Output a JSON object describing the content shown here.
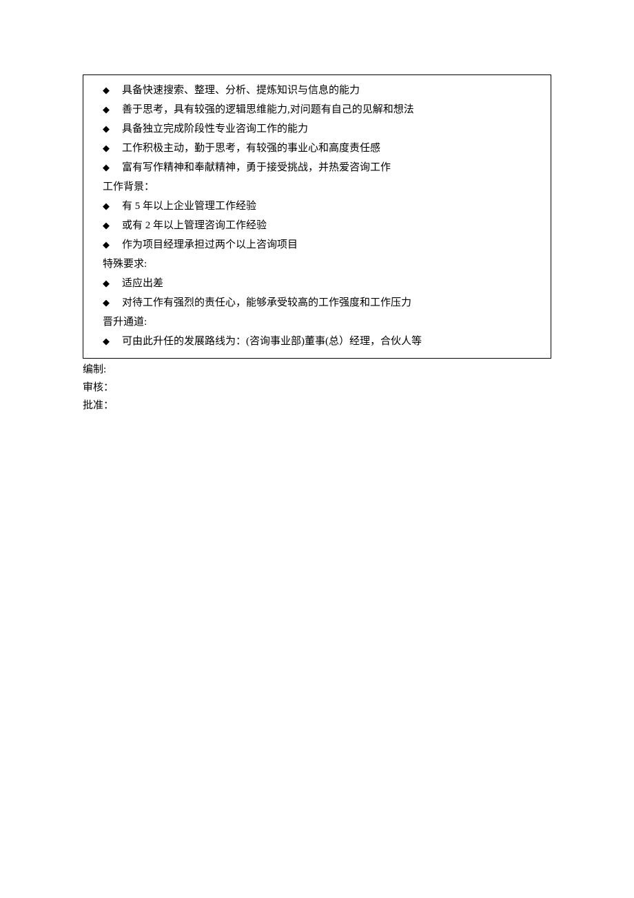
{
  "sections": [
    {
      "heading": null,
      "items": [
        "具备快速搜索、整理、分析、提炼知识与信息的能力",
        "善于思考，具有较强的逻辑思维能力,对问题有自己的见解和想法",
        "具备独立完成阶段性专业咨询工作的能力",
        "工作积极主动，勤于思考，有较强的事业心和高度责任感",
        "富有写作精神和奉献精神，勇于接受挑战，并热爱咨询工作"
      ]
    },
    {
      "heading": "工作背景：",
      "items": [
        "有 5 年以上企业管理工作经验",
        "或有 2 年以上管理咨询工作经验",
        "作为项目经理承担过两个以上咨询项目"
      ]
    },
    {
      "heading": "特殊要求:",
      "items": [
        "适应出差",
        "对待工作有强烈的责任心，能够承受较高的工作强度和工作压力"
      ]
    },
    {
      "heading": "晋升通道:",
      "items": [
        "可由此升任的发展路线为：(咨询事业部)董事(总）经理，合伙人等"
      ]
    }
  ],
  "footer": {
    "line1": "编制:",
    "line2": "审核：",
    "line3": "批准："
  }
}
